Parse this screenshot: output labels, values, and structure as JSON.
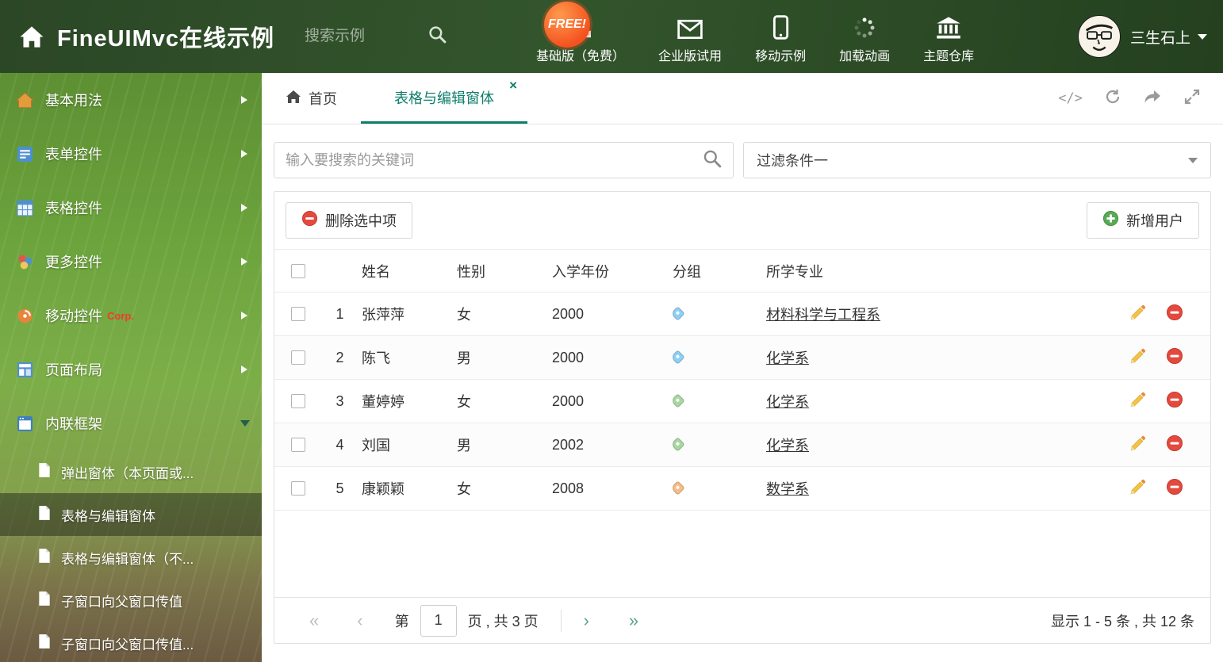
{
  "header": {
    "title": "FineUIMvc在线示例",
    "search_placeholder": "搜索示例",
    "free_badge": "FREE!",
    "nav_items": [
      {
        "label": "基础版（免费）"
      },
      {
        "label": "企业版试用"
      },
      {
        "label": "移动示例"
      },
      {
        "label": "加载动画"
      },
      {
        "label": "主题仓库"
      }
    ],
    "user_name": "三生石上"
  },
  "sidebar": {
    "items": [
      {
        "label": "基本用法"
      },
      {
        "label": "表单控件"
      },
      {
        "label": "表格控件"
      },
      {
        "label": "更多控件"
      },
      {
        "label": "移动控件",
        "badge": "Corp."
      },
      {
        "label": "页面布局"
      },
      {
        "label": "内联框架"
      }
    ],
    "subitems": [
      {
        "label": "弹出窗体（本页面或..."
      },
      {
        "label": "表格与编辑窗体"
      },
      {
        "label": "表格与编辑窗体（不..."
      },
      {
        "label": "子窗口向父窗口传值"
      },
      {
        "label": "子窗口向父窗口传值..."
      }
    ]
  },
  "tabs": {
    "home_label": "首页",
    "active_label": "表格与编辑窗体",
    "close_glyph": "×",
    "code_icon_text": "</>"
  },
  "filter": {
    "search_placeholder": "输入要搜索的关键词",
    "dropdown_value": "过滤条件一"
  },
  "toolbar": {
    "delete_label": "删除选中项",
    "add_label": "新增用户"
  },
  "table": {
    "headers": [
      "姓名",
      "性别",
      "入学年份",
      "分组",
      "所学专业"
    ],
    "rows": [
      {
        "num": "1",
        "name": "张萍萍",
        "gender": "女",
        "year": "2000",
        "tag_color": "#8fd0f5",
        "major": "材料科学与工程系"
      },
      {
        "num": "2",
        "name": "陈飞",
        "gender": "男",
        "year": "2000",
        "tag_color": "#8fd0f5",
        "major": "化学系"
      },
      {
        "num": "3",
        "name": "董婷婷",
        "gender": "女",
        "year": "2000",
        "tag_color": "#a8d8a0",
        "major": "化学系"
      },
      {
        "num": "4",
        "name": "刘国",
        "gender": "男",
        "year": "2002",
        "tag_color": "#a8d8a0",
        "major": "化学系"
      },
      {
        "num": "5",
        "name": "康颖颖",
        "gender": "女",
        "year": "2008",
        "tag_color": "#f6bd85",
        "major": "数学系"
      }
    ]
  },
  "pagination": {
    "first_glyph": "«",
    "prev_glyph": "‹",
    "next_glyph": "›",
    "last_glyph": "»",
    "label_prefix": "第",
    "page_value": "1",
    "label_suffix": "页 , 共 3 页",
    "summary": "显示 1 - 5 条 , 共 12 条"
  },
  "colors": {
    "accent": "#0e7e6b"
  }
}
